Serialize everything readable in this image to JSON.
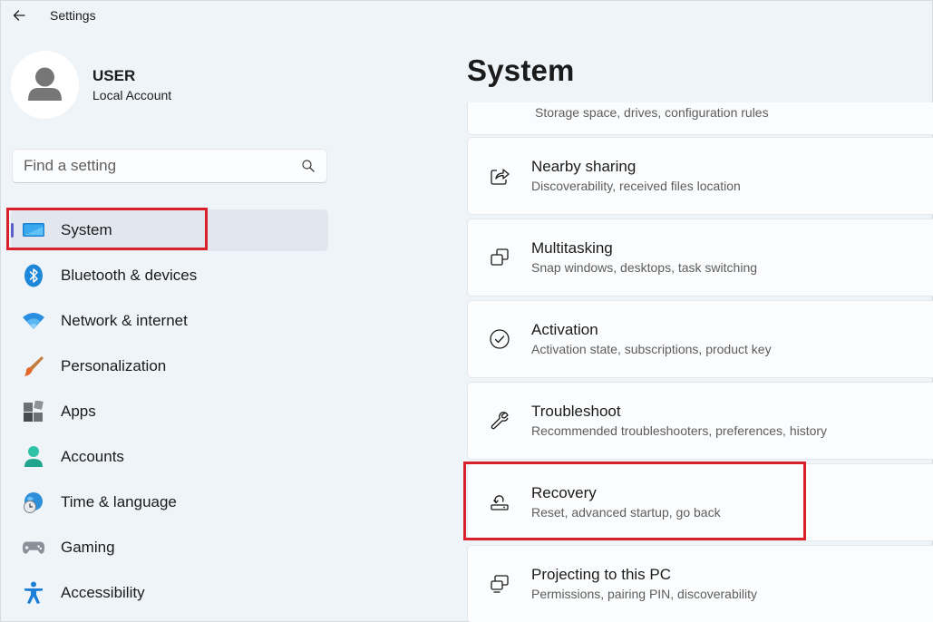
{
  "window": {
    "title": "Settings"
  },
  "user": {
    "name": "USER",
    "account_type": "Local Account"
  },
  "search": {
    "placeholder": "Find a setting"
  },
  "nav": [
    {
      "label": "System",
      "icon": "system-icon",
      "selected": true
    },
    {
      "label": "Bluetooth & devices",
      "icon": "bluetooth-icon"
    },
    {
      "label": "Network & internet",
      "icon": "wifi-icon"
    },
    {
      "label": "Personalization",
      "icon": "paintbrush-icon"
    },
    {
      "label": "Apps",
      "icon": "apps-icon"
    },
    {
      "label": "Accounts",
      "icon": "person-icon"
    },
    {
      "label": "Time & language",
      "icon": "globe-clock-icon"
    },
    {
      "label": "Gaming",
      "icon": "gamepad-icon"
    },
    {
      "label": "Accessibility",
      "icon": "accessibility-icon"
    }
  ],
  "main": {
    "title": "System",
    "partial_item_sub": "Storage space, drives, configuration rules",
    "items": [
      {
        "title": "Nearby sharing",
        "sub": "Discoverability, received files location",
        "icon": "share-icon"
      },
      {
        "title": "Multitasking",
        "sub": "Snap windows, desktops, task switching",
        "icon": "multitask-icon"
      },
      {
        "title": "Activation",
        "sub": "Activation state, subscriptions, product key",
        "icon": "checkmark-circle-icon"
      },
      {
        "title": "Troubleshoot",
        "sub": "Recommended troubleshooters, preferences, history",
        "icon": "wrench-icon"
      },
      {
        "title": "Recovery",
        "sub": "Reset, advanced startup, go back",
        "icon": "recovery-icon"
      },
      {
        "title": "Projecting to this PC",
        "sub": "Permissions, pairing PIN, discoverability",
        "icon": "projecting-icon"
      }
    ]
  },
  "colors": {
    "accent": "#5b5fc7",
    "highlight": "#d81f2a",
    "background": "#eff4f9"
  }
}
